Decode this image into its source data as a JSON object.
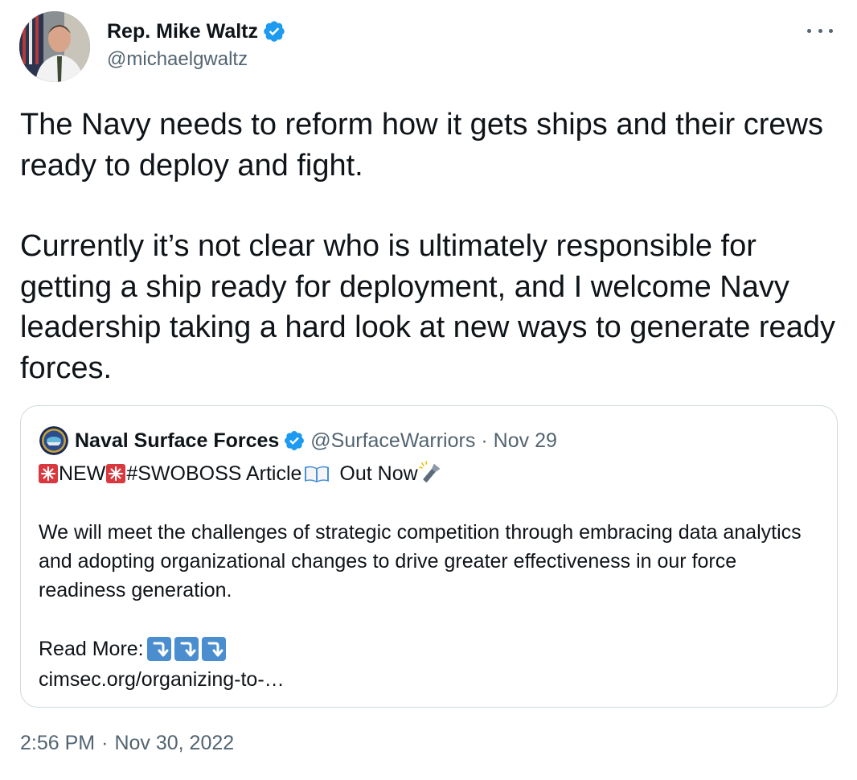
{
  "author": {
    "name": "Rep. Mike Waltz",
    "handle": "@michaelgwaltz",
    "verified": true
  },
  "more_icon": "more-horizontal-icon",
  "tweet": {
    "paragraph1": "The Navy needs to reform how it gets ships and their crews ready to deploy and fight.",
    "paragraph2": "Currently it’s not clear who is ultimately responsible for getting a ship ready for deployment, and I welcome Navy leadership taking a hard look at new ways to generate ready forces."
  },
  "quote": {
    "name": "Naval Surface Forces",
    "handle": "@SurfaceWarriors",
    "separator": "·",
    "date": "Nov 29",
    "verified": true,
    "line1": {
      "new": "NEW",
      "hashtag": "#SWOBOSS",
      "article": " Article",
      "out_now": " Out Now"
    },
    "body": "We will meet the challenges of strategic competition through embracing data analytics and adopting organizational changes to drive greater effectiveness in our force readiness generation.",
    "read_more": "Read More:",
    "link": "cimsec.org/organizing-to-…"
  },
  "timestamp": {
    "time": "2:56 PM",
    "separator": "·",
    "date": "Nov 30, 2022"
  },
  "colors": {
    "text": "#0f1419",
    "secondary": "#536471",
    "verified_blue": "#1d9bf0",
    "border": "#cfd9de",
    "arrow_box": "#4b8ed0"
  }
}
